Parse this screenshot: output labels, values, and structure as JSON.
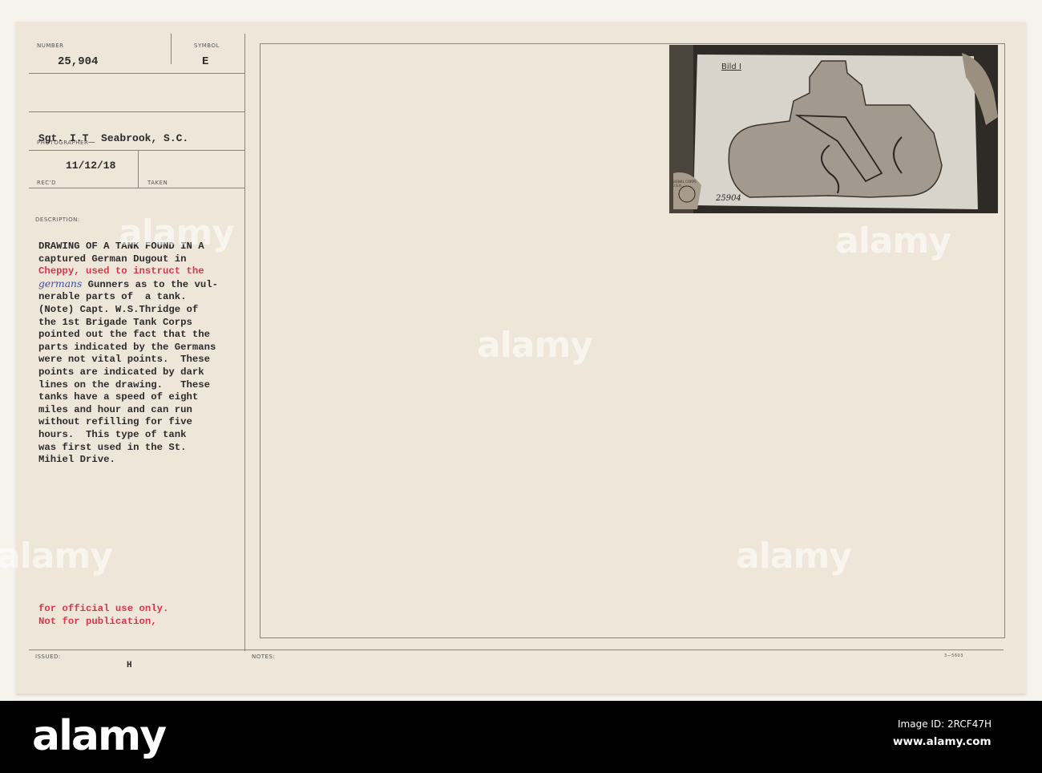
{
  "card": {
    "number_label": "NUMBER",
    "number": "25,904",
    "symbol_label": "SYMBOL",
    "symbol": "E",
    "photographer_label": "PHOTOGRAPHER",
    "photographer": "Sgt. I.T_ Seabrook, S.C.",
    "recd_label": "REC'D",
    "recd_date": "11/12/18",
    "taken_label": "TAKEN",
    "description_label": "DESCRIPTION:",
    "description_lines": [
      "DRAWING OF A TANK FOUND IN A",
      "captured German Dugout in",
      "Cheppy, used to instruct the",
      " Gunners as to the vul-",
      "nerable parts of  a tank.",
      "(Note) Capt. W.S.Thridge of",
      "the 1st Brigade Tank Corps",
      "pointed out the fact that the",
      "parts indicated by the Germans",
      "were not vital points.  These",
      "points are indicated by dark",
      "lines on the drawing.   These",
      "tanks have a speed of eight",
      "miles and hour and can run",
      "without refilling for five",
      "hours.  This type of tank",
      "was first used in the St.",
      "Mihiel Drive."
    ],
    "handwritten_word": "germans",
    "restriction_lines": [
      "for official use only.",
      "Not for publication,"
    ],
    "issued_label": "ISSUED:",
    "issued_mark": "H",
    "notes_label": "NOTES:",
    "form_number": "3—5603"
  },
  "photo": {
    "caption": "Bild I",
    "stamp_text": "SIGNAL CORPS U.S.A.",
    "photo_number": "25904"
  },
  "watermark": {
    "text": "alamy",
    "image_id": "Image ID: 2RCF47H",
    "url": "www.alamy.com"
  },
  "colors": {
    "paper": "#efe6da",
    "red_type": "#d8364b",
    "footer": "#000000"
  }
}
